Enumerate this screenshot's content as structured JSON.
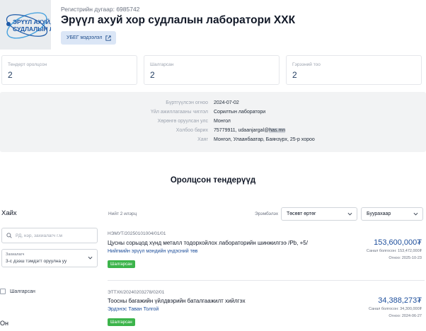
{
  "org": {
    "logo_text": [
      "ЭРҮҮЛ АХУЙ, Х",
      "СУДЛАЛЫН ЛА"
    ],
    "registration": "Регистрийн дугаар: 6985742",
    "name": "Эрүүл ахуй хор судлалын лаборатори ХХК",
    "ubeg_button": "УБЕГ мэдээлэл"
  },
  "stats": [
    {
      "label": "Тендерт оролцсон",
      "value": "2"
    },
    {
      "label": "Шалгарсан",
      "value": "2"
    },
    {
      "label": "Гэрээний тоо",
      "value": "2"
    }
  ],
  "info": [
    {
      "key": "Бүртгүүлсэн огноо",
      "value": "2024-07-02"
    },
    {
      "key": "Үйл ажиллагааны чиглэл",
      "value": "Сорилтын лаборатори"
    },
    {
      "key": "Хөрөнгө оруулсан улс",
      "value": "Монгол"
    },
    {
      "key": "Холбоо барих",
      "value": "75779911, udaanjargal@",
      "value_hl": "has.mn"
    },
    {
      "key": "Хаяг",
      "value": "Монгол, Улаанбаатар, Баянзүрх, 25-р хороо"
    }
  ],
  "section_title": "Оролцсон тендерүүд",
  "filters": {
    "search_title": "Хайх",
    "search_placeholder": "РД, нэр, захиалагч г.м",
    "select_label": "Захиалагч",
    "select_value": "3-с дээш тэмдэгт оруулна уу",
    "checkbox_label": "Шалгарсан",
    "year_title": "Он"
  },
  "results": {
    "count": "Нийт 2 илэрц",
    "sort_label": "Эрэмбэлэх",
    "sort_value": "Төсөвт өртөг",
    "order_value": "Буурахаар"
  },
  "tenders": [
    {
      "code": "НЭМУТ/20250101004/01/01",
      "name": "Цусны сорьцод хүнд металл тодорхойлох лабораторийн шинжилгээ /Pb, +5/",
      "org": "Нийгмийн эрүүл мэндийн үндэсний төв",
      "badge": "Шалгарсан",
      "price": "153,600,000₮",
      "won": "Санал болгосон: 153,472,000₮",
      "deadline": "Огноо: 2025-10-23"
    },
    {
      "code": "ЭТТХК/20240203278/02/01",
      "name": "Тоосны багажийн үйлдвэрийн баталгаажилт хийлгэх",
      "org": "Эрдэнэс Таван Толгой",
      "badge": "Шалгарсан",
      "price": "34,388,273₮",
      "won": "Санал болгосон: 34,300,000₮",
      "deadline": "Огноо: 2024-06-27"
    }
  ]
}
